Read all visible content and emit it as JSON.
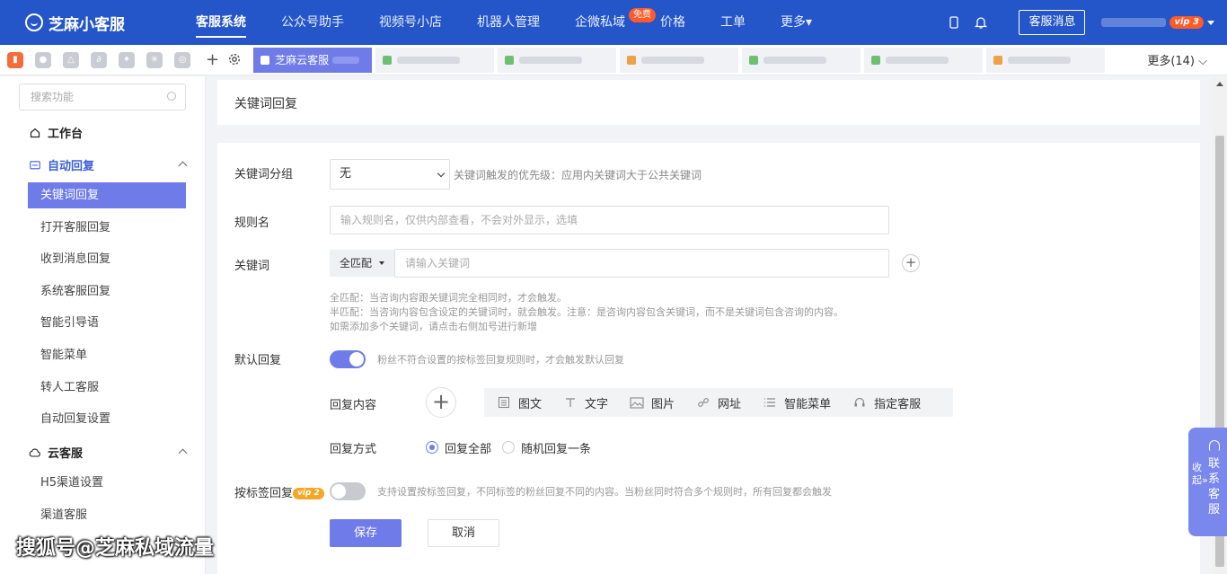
{
  "app": {
    "logo_text": "芝麻小客服"
  },
  "nav": {
    "items": [
      {
        "label": "客服系统",
        "active": true
      },
      {
        "label": "公众号助手"
      },
      {
        "label": "视频号小店"
      },
      {
        "label": "机器人管理"
      },
      {
        "label": "企微私域",
        "badge": "免费"
      },
      {
        "label": "价格"
      },
      {
        "label": "工单"
      },
      {
        "label": "更多▾"
      }
    ],
    "kefu_button": "客服消息",
    "vip_badge": "vip 3"
  },
  "tabbar": {
    "active_tab": "芝麻云客服",
    "more": "更多(14) ⌵",
    "tab_colors": [
      "#6fbf73",
      "#6fbf73",
      "#f0a046",
      "#6fbf73",
      "#6fbf73",
      "#f0a046"
    ]
  },
  "sidebar": {
    "search_placeholder": "搜索功能",
    "workbench": "工作台",
    "auto_reply": "自动回复",
    "items": [
      "关键词回复",
      "打开客服回复",
      "收到消息回复",
      "系统客服回复",
      "智能引导语",
      "智能菜单",
      "转人工客服",
      "自动回复设置"
    ],
    "cloud_service": "云客服",
    "cloud_items": [
      "H5渠道设置",
      "渠道客服"
    ]
  },
  "page": {
    "title": "关键词回复",
    "group_label": "关键词分组",
    "group_value": "无",
    "group_hint": "关键词触发的优先级：应用内关键词大于公共关键词",
    "rule_label": "规则名",
    "rule_placeholder": "输入规则名，仅供内部查看，不会对外显示，选填",
    "keyword_label": "关键词",
    "match_mode": "全匹配",
    "keyword_placeholder": "请输入关键词",
    "tip1": "全匹配：当咨询内容跟关键词完全相同时，才会触发。",
    "tip2": "半匹配：当咨询内容包含设定的关键词时，就会触发。注意：是咨询内容包含关键词，而不是关键词包含咨询的内容。",
    "tip3": "如需添加多个关键词，请点击右侧加号进行新增",
    "default_label": "默认回复",
    "default_hint": "粉丝不符合设置的按标签回复规则时，才会触发默认回复",
    "content_label": "回复内容",
    "content_types": [
      "图文",
      "文字",
      "图片",
      "网址",
      "智能菜单",
      "指定客服"
    ],
    "method_label": "回复方式",
    "method_all": "回复全部",
    "method_random": "随机回复一条",
    "tag_label": "按标签回复",
    "tag_vip": "vip 2",
    "tag_hint": "支持设置按标签回复，不同标签的粉丝回复不同的内容。当粉丝同时符合多个规则时，所有回复都会触发",
    "save": "保存",
    "cancel": "取消"
  },
  "float_panel": {
    "collapse": "收起»",
    "contact": "联系客服"
  },
  "watermark": "搜狐号@芝麻私域流量"
}
